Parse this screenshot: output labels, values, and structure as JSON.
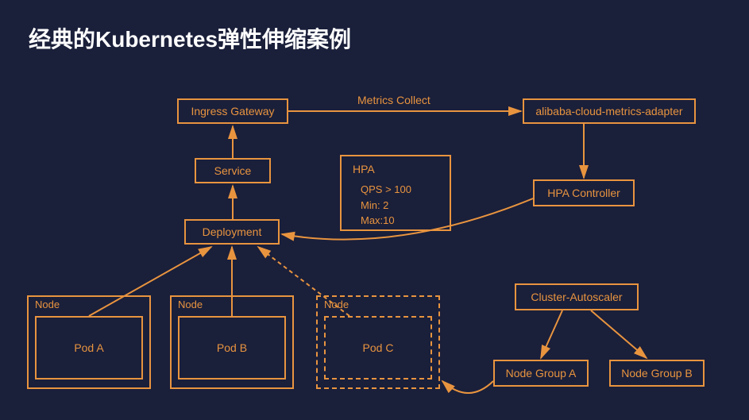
{
  "title": "经典的Kubernetes弹性伸缩案例",
  "ingress": "Ingress Gateway",
  "service": "Service",
  "deployment": "Deployment",
  "metricsAdapter": "alibaba-cloud-metrics-adapter",
  "hpaController": "HPA Controller",
  "clusterAutoscaler": "Cluster-Autoscaler",
  "nodeGroupA": "Node Group A",
  "nodeGroupB": "Node Group B",
  "nodeLabel": "Node",
  "podA": "Pod A",
  "podB": "Pod B",
  "podC": "Pod C",
  "hpa": {
    "title": "HPA",
    "qps": "QPS > 100",
    "min": "Min: 2",
    "max": "Max:10"
  },
  "edgeMetrics": "Metrics Collect"
}
